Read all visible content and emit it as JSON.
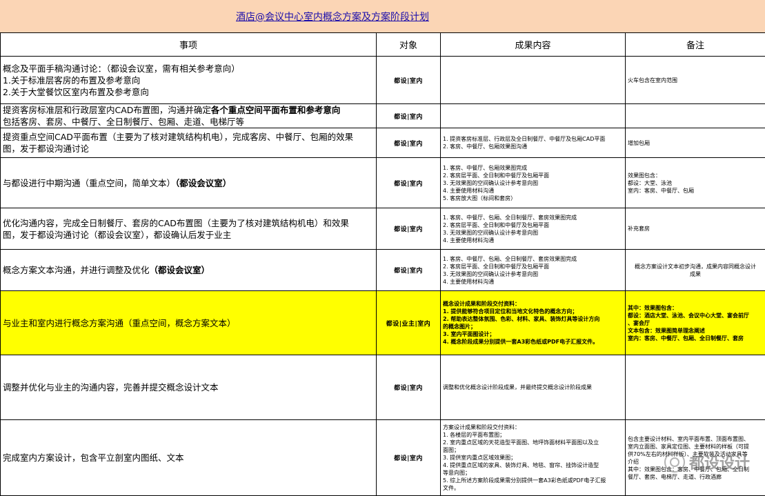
{
  "title": "酒店@会议中心室内概念方案及方案阶段计划",
  "headers": [
    "事项",
    "对象",
    "成果内容",
    "备注"
  ],
  "rows": [
    {
      "item_lines": [
        "概念及平面手稿沟通讨论：（都设会议室，需有相关参考意向）",
        "1.关于标准层客房的布置及参考意向",
        "2.关于大堂餐饮区室内布置及参考意向"
      ],
      "target": "都设|室内",
      "result_lines": [],
      "remark_lines": [
        "火车包含在室内范围"
      ]
    },
    {
      "item_lines": [
        "提资客房标准层和行政层室内CAD布置图，沟通并确定",
        "包括客房、套房、中餐厅、全日制餐厅、包厢、走道、电梯厅等"
      ],
      "item_bold": "各个重点空间平面布置和参考意向",
      "target": "都设|室内",
      "result_lines": [],
      "remark_lines": []
    },
    {
      "item_lines": [
        "提资重点空间CAD平面布置（主要为了核对建筑结构机电），完成客房、中餐厅、包厢的效果",
        "图，发于都设沟通讨论"
      ],
      "target": "都设|室内",
      "result_lines": [
        "1. 提资客房标准层、行政层及全日制餐厅、中餐厅及包厢CAD平面",
        "2. 客房、中餐厅、包厢效果图沟通"
      ],
      "remark_lines": [
        "增加包厢"
      ]
    },
    {
      "item_lines": [
        "与都设进行中期沟通（重点空间，简单文本）"
      ],
      "item_bold": "（都设会议室）",
      "target": "都设|室内",
      "result_lines": [
        "1. 客房、中餐厅、包厢效果图完成",
        "2. 客房层平面、全日制和中餐厅及包厢平面",
        "3. 无效果图的空间确认设计参考意向图",
        "4. 主要使用材料沟通",
        "5. 客房放大图（标间和套房）"
      ],
      "remark_lines": [
        "效果图包含：",
        "都设：大堂、泳池",
        "室内：客房、中餐厅、包厢"
      ]
    },
    {
      "item_lines": [
        "优化沟通内容，完成全日制餐厅、套房的CAD布置图（主要为了核对建筑结构机电）和效果",
        "图，发于都设沟通讨论（都设会议室），都设确认后发于业主"
      ],
      "target": "都设|室内",
      "result_lines": [
        "1. 客房、中餐厅、包厢、全日制餐厅、套房效果图完成",
        "2. 客房层平面、全日制和中餐厅及包厢平面",
        "3. 无效果图的空间确认设计参考意向图",
        "4. 主要使用材料沟通"
      ],
      "remark_lines": [
        "补充套房"
      ]
    },
    {
      "item_lines": [
        "概念方案文本沟通，并进行调整及优化"
      ],
      "item_bold": "（都设会议室）",
      "target": "都设|室内",
      "result_lines": [
        "1. 客房、中餐厅、包厢、全日制餐厅、套房效果图完成",
        "2. 客房层平面、全日制和中餐厅及包厢平面",
        "3. 无效果图的空间确认设计参考意向图",
        "4. 主要使用材料沟通"
      ],
      "remark_lines": [
        "概念方案设计文本初步沟通，成果内容同概念设计",
        "成果"
      ]
    },
    {
      "item_lines": [
        "与业主和室内进行概念方案沟通（重点空间，概念方案文本）"
      ],
      "target": "都设|业主|室内",
      "highlight": true,
      "result_lines": [
        "概念设计成果和阶段交付资料：",
        "1.   提供能够符合项目定位和当地文化特色的概念方向；",
        "2.   帮助表达整体氛围、色彩、材料、家具、装饰灯具等设计方向",
        "的概念图片；",
        "3.   室内平面图设计；",
        "4.   概念阶段成果分别提供一套A3彩色纸或PDF电子汇报文件。"
      ],
      "remark_lines": [
        "其中：效果图包含：",
        "都设：酒店大堂、泳池、会议中心大堂、宴会前厅",
        "、宴会厅",
        "文本包含：效果图简单理念阐述",
        "室内：客房、中餐厅、包厢、全日制餐厅、套房"
      ]
    },
    {
      "item_lines": [
        "调整并优化与业主的沟通内容，完善并提交概念设计文本"
      ],
      "target": "都设|室内",
      "result_lines": [
        "调整和优化概念设计阶段成果，并最终提交概念设计阶段成果"
      ],
      "remark_lines": []
    },
    {
      "item_lines": [
        "完成室内方案设计，包含平立剖室内图纸、文本"
      ],
      "target": "都设|室内",
      "result_lines": [
        "方案设计成果和阶段交付资料：",
        "1.   各楼层的平面布置图；",
        "2.   室内重点区域的天花造型平面图、地坪饰面材料平面图以及立",
        "面图；",
        "3.   提供室内重点区域效果图；",
        "4.   提供重点区域的家具、装饰灯具、地毯、窗帘、挂饰设计造型",
        "等意向图；",
        "5.   综上所述方案阶段成果需分别提供一套A3彩色纸或PDF电子汇报",
        "文件。"
      ],
      "remark_lines": [
        "包含主要设计材料、室内平面布置、顶面布置图、",
        "室内立面图、家具定位图、主要材料的样板（可提",
        "供70%左右的材料样板）、主要软装及活动家具等",
        "介绍",
        "其中：效果图包含：客房、中餐厅、包厢、全日制",
        "餐厅、套房、电梯厅、走道、行政酒廊"
      ]
    }
  ],
  "watermark": "都设设计",
  "watermark_icon": "wechat-icon"
}
